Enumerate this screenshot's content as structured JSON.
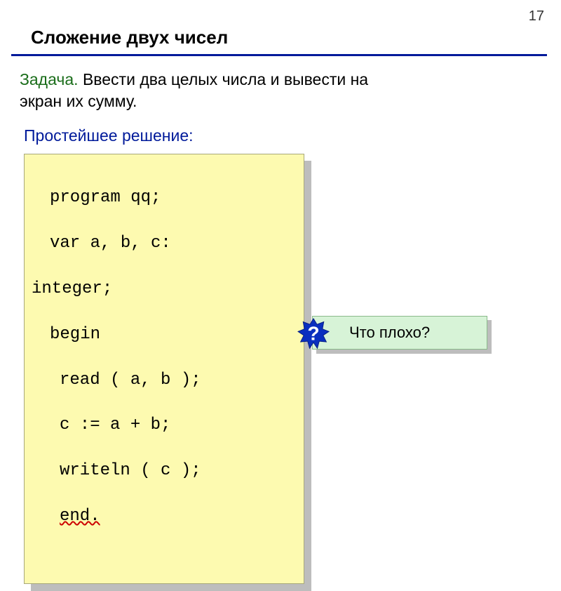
{
  "page_number": "17",
  "heading": "Сложение двух чисел",
  "task": {
    "label": "Задача.",
    "text_line1": " Ввести два целых числа и вывести на",
    "text_line2": "экран их сумму."
  },
  "solution_label": "Простейшее решение:",
  "code": {
    "l1": "program qq;",
    "l2": "var a, b, c:",
    "l3": "integer;",
    "l4": "begin",
    "l5": "read ( a, b );",
    "l6": "c := a + b;",
    "l7": "writeln ( c );",
    "l8": "end."
  },
  "callout": {
    "badge": "?",
    "text": "Что плохо?"
  }
}
